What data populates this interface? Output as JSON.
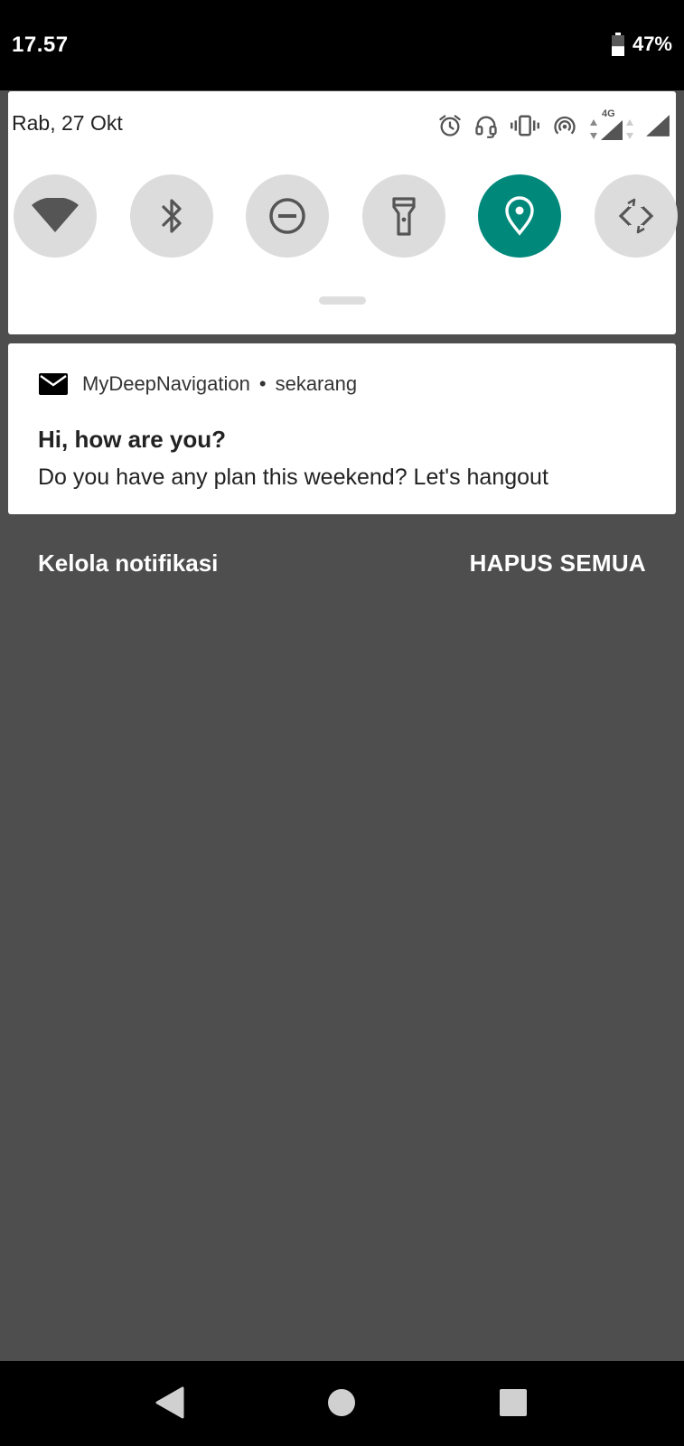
{
  "status_bar": {
    "time": "17.57",
    "battery_percent": "47%",
    "battery_level": 0.47
  },
  "quick_settings": {
    "date": "Rab, 27 Okt",
    "status_icons": [
      "alarm-icon",
      "headset-icon",
      "vibrate-icon",
      "hotspot-icon",
      "data-arrows-icon",
      "signal-icon",
      "signal-icon"
    ],
    "network_label": "4G",
    "tiles": [
      {
        "name": "wifi",
        "icon": "wifi-icon",
        "active": false
      },
      {
        "name": "bluetooth",
        "icon": "bluetooth-icon",
        "active": false
      },
      {
        "name": "do-not-disturb",
        "icon": "do-not-disturb-icon",
        "active": false
      },
      {
        "name": "flashlight",
        "icon": "flashlight-icon",
        "active": false
      },
      {
        "name": "location",
        "icon": "location-icon",
        "active": true
      },
      {
        "name": "auto-rotate",
        "icon": "rotate-icon",
        "active": false
      }
    ],
    "active_color": "#00897b",
    "inactive_color": "#dcdcdc"
  },
  "notification": {
    "app_icon": "mail-icon",
    "app_name": "MyDeepNavigation",
    "separator": "•",
    "time": "sekarang",
    "title": "Hi, how are you?",
    "body": "Do you have any plan this weekend? Let's hangout"
  },
  "footer": {
    "manage_label": "Kelola notifikasi",
    "clear_all_label": "HAPUS SEMUA"
  },
  "nav_bar": {
    "buttons": [
      "back-icon",
      "home-icon",
      "recents-icon"
    ]
  }
}
